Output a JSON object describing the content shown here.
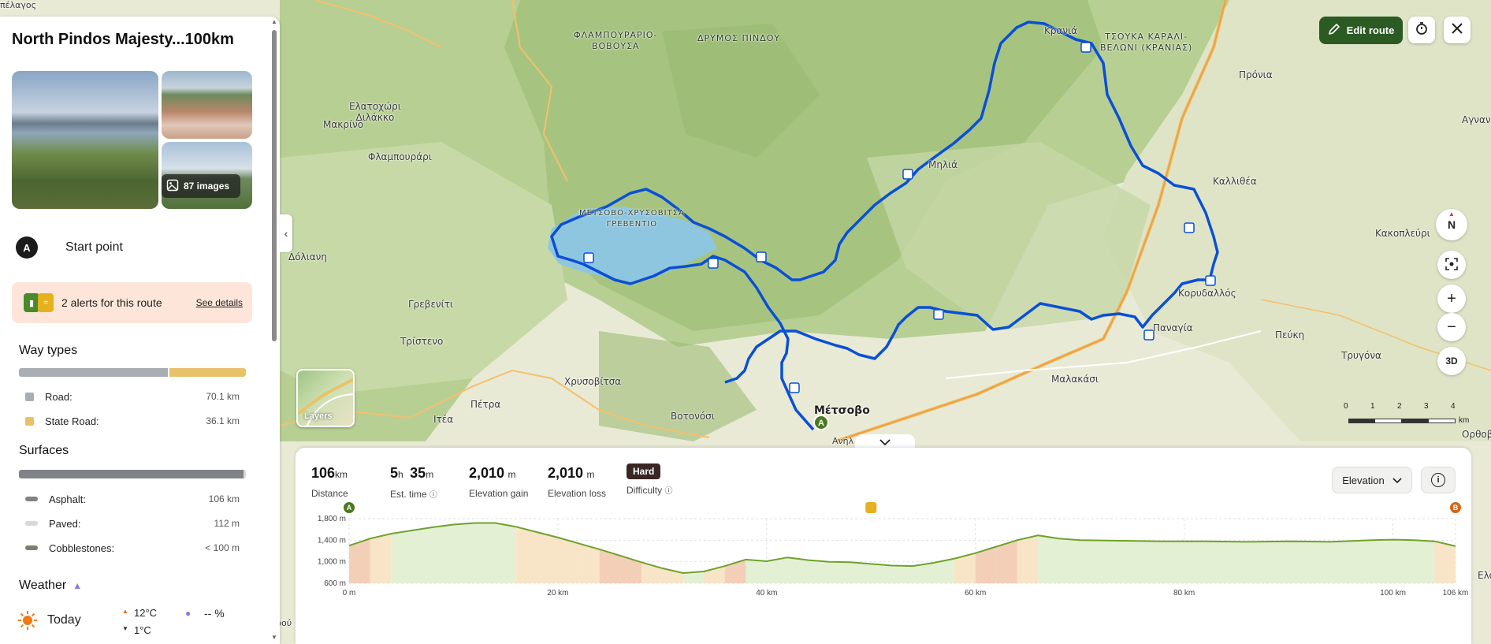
{
  "header": {
    "edit_route": "Edit route",
    "compass": "N",
    "three_d": "3D",
    "zoom_in": "+",
    "zoom_out": "−"
  },
  "map": {
    "layers_label": "Layers",
    "scale": {
      "ticks": [
        "0",
        "1",
        "2",
        "3",
        "4"
      ],
      "unit": "km"
    },
    "labels": [
      {
        "text": "πέλαγος"
      },
      {
        "text": "ΦΛΑΜΠΟΥΡΑΡΙΟ-\nΒΟΒΟΥΣΑ"
      },
      {
        "text": "ΔΡΥΜΟΣ ΠΙΝΔΟΥ"
      },
      {
        "text": "ΤΣΟΥΚΑ ΚΑΡΑΛΙ-\nΒΕΛΩΝΙ (ΚΡΑΝΙΑΣ)"
      },
      {
        "text": "Κρανιά"
      },
      {
        "text": "Πρόνια"
      },
      {
        "text": "Αγναντ"
      },
      {
        "text": "Ελατοχώρι\nΔιλάκκο"
      },
      {
        "text": "Μακρίνο"
      },
      {
        "text": "Φλαμπουράρι"
      },
      {
        "text": "Μηλιά"
      },
      {
        "text": "Καλλιθέα"
      },
      {
        "text": "ΜΕΤΣΟΒΟ-ΧΡΥΣΟΒΙΤΣΑ\nΓΡΕΒΕΝΤΙΟ"
      },
      {
        "text": "Κακοπλεύρι"
      },
      {
        "text": "Δόλιανη"
      },
      {
        "text": "Γρεβενίτι"
      },
      {
        "text": "Κορυδαλλός"
      },
      {
        "text": "Παναγία"
      },
      {
        "text": "Πεύκη"
      },
      {
        "text": "Τρίστενο"
      },
      {
        "text": "Τρυγόνα"
      },
      {
        "text": "Χρυσοβίτσα"
      },
      {
        "text": "Μαλακάσι"
      },
      {
        "text": "Πέτρα"
      },
      {
        "text": "Ιτέα"
      },
      {
        "text": "Βοτονόσι"
      },
      {
        "text": "Μέτσοβο"
      },
      {
        "text": "Ανήλ"
      },
      {
        "text": "Ορθοβ"
      },
      {
        "text": "Ελά"
      },
      {
        "text": "ρού"
      }
    ]
  },
  "sidebar": {
    "title": "North Pindos Majesty...100km",
    "images_count": "87 images",
    "start": {
      "badge": "A",
      "label": "Start point"
    },
    "alerts": {
      "text": "2 alerts for this route",
      "link": "See details"
    },
    "way_types": {
      "title": "Way types",
      "items": [
        {
          "label": "Road:",
          "value": "70.1 km",
          "color": "#a9adb4",
          "share": 0.66
        },
        {
          "label": "State Road:",
          "value": "36.1 km",
          "color": "#e7c26a",
          "share": 0.34
        }
      ]
    },
    "surfaces": {
      "title": "Surfaces",
      "items": [
        {
          "label": "Asphalt:",
          "value": "106 km",
          "color": "#7f8287",
          "share": 0.99
        },
        {
          "label": "Paved:",
          "value": "112 m",
          "color": "#d8d8d8",
          "share": 0.01
        },
        {
          "label": "Cobblestones:",
          "value": "< 100 m",
          "color": "#7d7d73",
          "share": 0.0
        }
      ]
    },
    "weather": {
      "title": "Weather",
      "today": "Today",
      "high": "12°C",
      "low": "1°C",
      "rain": "-- %"
    }
  },
  "stats": {
    "distance": {
      "num": "106",
      "unit": "km",
      "label": "Distance"
    },
    "time": {
      "h": "5",
      "h_unit": "h",
      "m": "35",
      "m_unit": "m",
      "label": "Est. time"
    },
    "gain": {
      "num": "2,010",
      "unit": "m",
      "label": "Elevation gain"
    },
    "loss": {
      "num": "2,010",
      "unit": "m",
      "label": "Elevation loss"
    },
    "difficulty": {
      "badge": "Hard",
      "label": "Difficulty"
    },
    "chart_mode": "Elevation",
    "info_icon": "i"
  },
  "chart_data": {
    "type": "area",
    "title": "",
    "xlabel": "",
    "ylabel": "",
    "x_unit": "km",
    "y_unit": "m",
    "xlim": [
      0,
      106
    ],
    "ylim": [
      600,
      1800
    ],
    "x_ticks": [
      "0 m",
      "20 km",
      "40 km",
      "60 km",
      "80 km",
      "100 km",
      "106 km"
    ],
    "x_tick_values": [
      0,
      20,
      40,
      60,
      80,
      100,
      106
    ],
    "y_ticks": [
      "600 m",
      "1,000 m",
      "1,400 m",
      "1,800 m"
    ],
    "y_tick_values": [
      600,
      1000,
      1400,
      1800
    ],
    "markers": [
      {
        "label": "A",
        "x": 0
      },
      {
        "label": "B",
        "x": 106
      }
    ],
    "series": [
      {
        "x": [
          0,
          2,
          4,
          6,
          8,
          10,
          12,
          14,
          16,
          18,
          20,
          22,
          24,
          26,
          28,
          30,
          32,
          34,
          36,
          38,
          40,
          42,
          44,
          46,
          48,
          50,
          52,
          54,
          56,
          58,
          60,
          62,
          64,
          66,
          68,
          70,
          74,
          78,
          82,
          86,
          90,
          94,
          98,
          100,
          102,
          104,
          106
        ],
        "y": [
          1300,
          1430,
          1520,
          1580,
          1640,
          1690,
          1720,
          1720,
          1650,
          1550,
          1450,
          1340,
          1230,
          1110,
          990,
          880,
          790,
          820,
          920,
          1040,
          1010,
          1080,
          1030,
          1000,
          990,
          960,
          930,
          920,
          980,
          1060,
          1160,
          1280,
          1400,
          1490,
          1430,
          1400,
          1390,
          1380,
          1380,
          1370,
          1380,
          1370,
          1400,
          1410,
          1400,
          1380,
          1290
        ]
      }
    ]
  }
}
